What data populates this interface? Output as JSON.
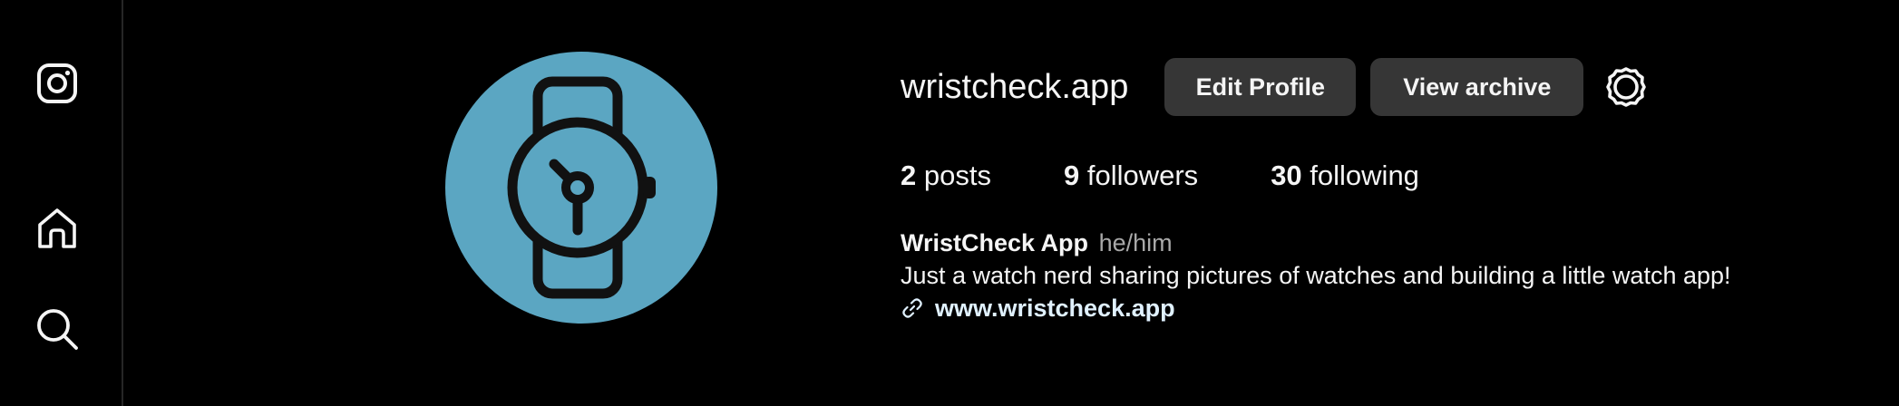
{
  "sidebar": {
    "items": [
      {
        "icon": "instagram-logo-icon"
      },
      {
        "icon": "home-icon"
      },
      {
        "icon": "search-icon"
      }
    ]
  },
  "profile": {
    "username": "wristcheck.app",
    "buttons": {
      "edit_label": "Edit Profile",
      "archive_label": "View archive"
    },
    "settings_icon": "gear-icon",
    "avatar": {
      "icon": "watch-icon",
      "background_color": "#5ba6c2"
    },
    "stats": {
      "posts_count": "2",
      "posts_label": "posts",
      "followers_count": "9",
      "followers_label": "followers",
      "following_count": "30",
      "following_label": "following"
    },
    "bio": {
      "full_name": "WristCheck App",
      "pronouns": "he/him",
      "text": "Just a watch nerd sharing pictures of watches and building a little watch app!",
      "link_icon": "link-icon",
      "link": "www.wristcheck.app"
    }
  },
  "colors": {
    "background": "#000000",
    "button_bg": "#363636",
    "text": "#f5f5f5",
    "secondary_text": "#a8a8a8",
    "link_text": "#e0f1ff"
  }
}
